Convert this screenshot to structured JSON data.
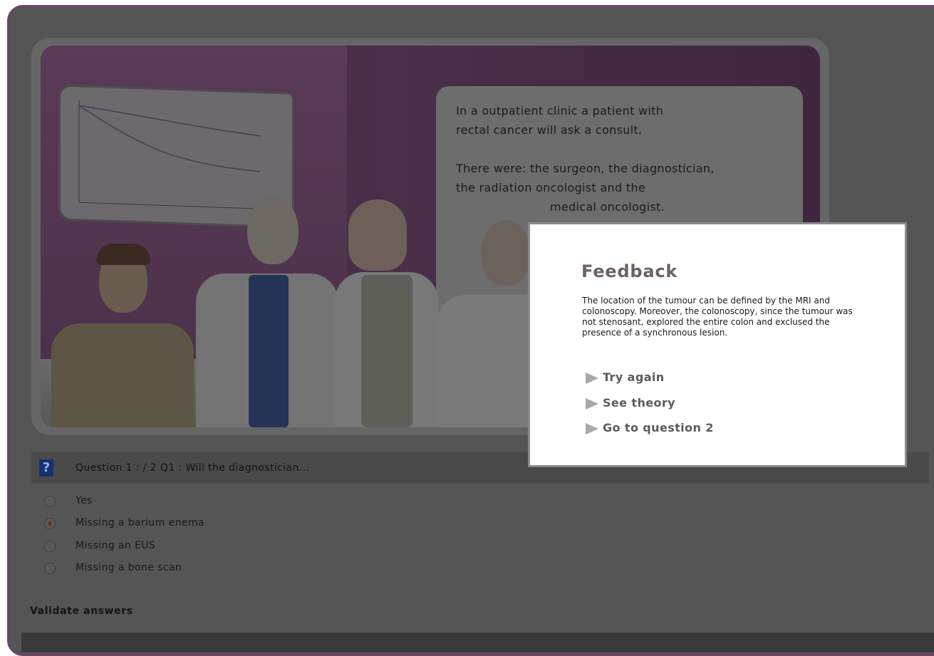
{
  "scene": {
    "speech_lines": [
      "In a outpatient clinic a patient with",
      "rectal cancer will ask a consult.",
      "",
      "There were: the surgeon, the diagnostician,",
      "the radiation oncologist and the",
      "medical oncologist."
    ]
  },
  "question": {
    "icon_glyph": "?",
    "text": "Question 1 : / 2 Q1 : Will the diagnostician..."
  },
  "options": [
    {
      "label": "Yes",
      "checked": false
    },
    {
      "label": "Missing a barium enema",
      "checked": true
    },
    {
      "label": "Missing an EUS",
      "checked": false
    },
    {
      "label": "Missing a bone scan",
      "checked": false
    }
  ],
  "validate_label": "Validate answers",
  "feedback": {
    "title": "Feedback",
    "text": "The location of the tumour can be defined by the MRI and colonoscopy. Moreover, the colonoscopy, since the tumour was not stenosant, explored the entire colon and exclused the presence of a synchronous lesion.",
    "links": [
      "Try again",
      "See theory",
      "Go to question 2"
    ]
  },
  "colors": {
    "frame_border": "#7a3b73",
    "overlay": "#555555",
    "feedback_title": "#6b6360"
  }
}
